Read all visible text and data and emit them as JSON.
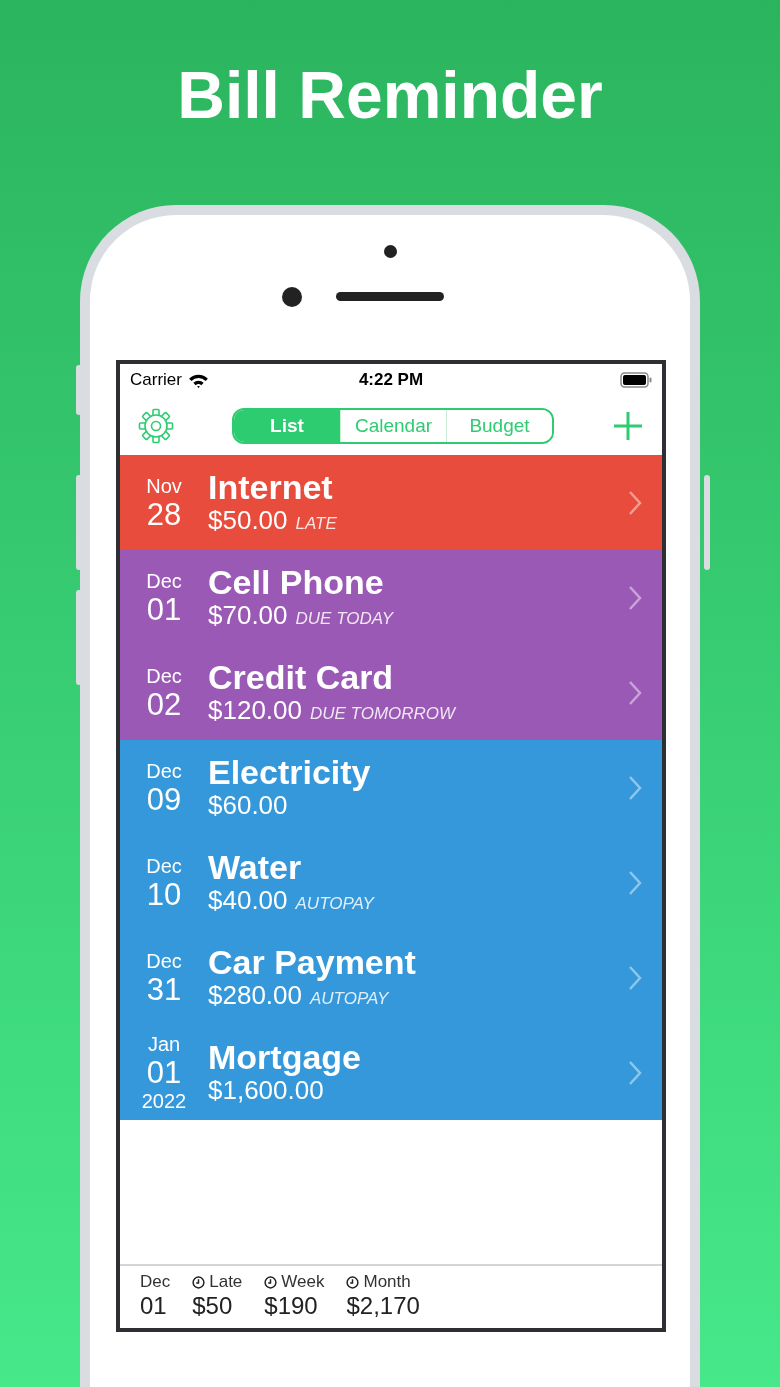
{
  "headline": "Bill Reminder",
  "status_bar": {
    "carrier": "Carrier",
    "time": "4:22 PM"
  },
  "tabs": [
    {
      "label": "List",
      "selected": true
    },
    {
      "label": "Calendar",
      "selected": false
    },
    {
      "label": "Budget",
      "selected": false
    }
  ],
  "bills": [
    {
      "month": "Nov",
      "day": "28",
      "name": "Internet",
      "amount": "$50.00",
      "note": "LATE",
      "color": "#e74c3c"
    },
    {
      "month": "Dec",
      "day": "01",
      "name": "Cell Phone",
      "amount": "$70.00",
      "note": "DUE TODAY",
      "color": "#9b59b6"
    },
    {
      "month": "Dec",
      "day": "02",
      "name": "Credit Card",
      "amount": "$120.00",
      "note": "DUE TOMORROW",
      "color": "#9b59b6"
    },
    {
      "month": "Dec",
      "day": "09",
      "name": "Electricity",
      "amount": "$60.00",
      "color": "#3498db"
    },
    {
      "month": "Dec",
      "day": "10",
      "name": "Water",
      "amount": "$40.00",
      "note": "AUTOPAY",
      "color": "#3498db"
    },
    {
      "month": "Dec",
      "day": "31",
      "name": "Car Payment",
      "amount": "$280.00",
      "note": "AUTOPAY",
      "color": "#3498db"
    },
    {
      "month": "Jan",
      "day": "01",
      "year": "2022",
      "name": "Mortgage",
      "amount": "$1,600.00",
      "color": "#3498db"
    }
  ],
  "summary": [
    {
      "kind": "date",
      "label": "Dec",
      "value": "01"
    },
    {
      "kind": "total",
      "label": "Late",
      "value": "$50"
    },
    {
      "kind": "total",
      "label": "Week",
      "value": "$190"
    },
    {
      "kind": "total",
      "label": "Month",
      "value": "$2,170"
    }
  ]
}
